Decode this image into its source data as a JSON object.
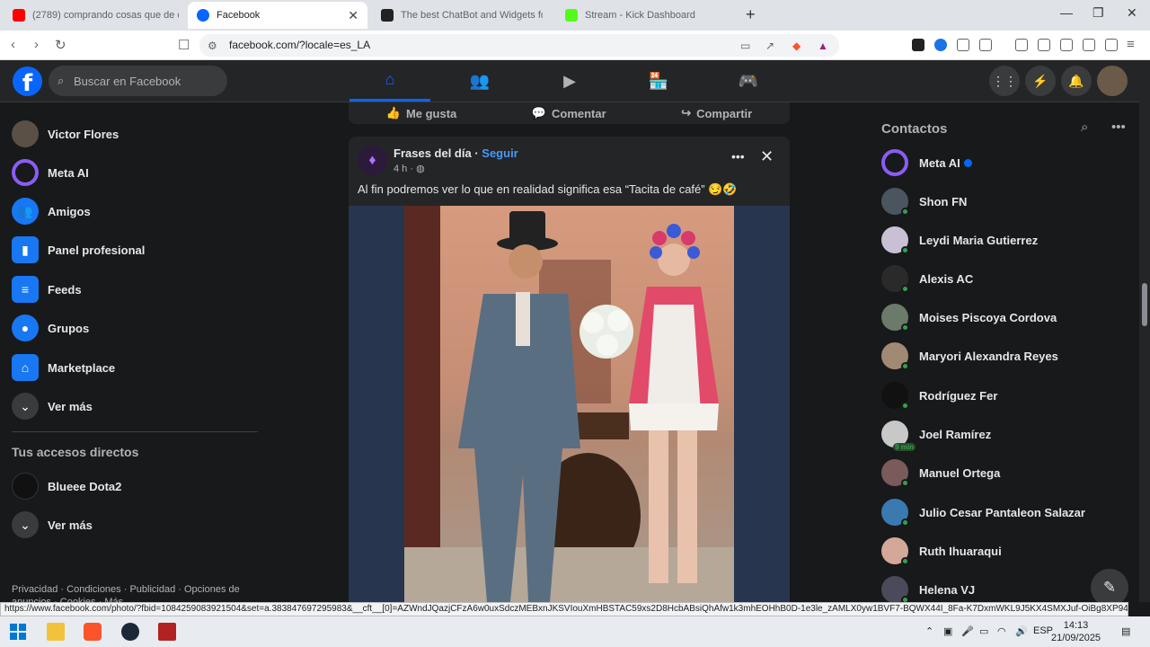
{
  "browser": {
    "tabs": [
      {
        "title": "(2789) comprando cosas que de chic",
        "color": "#ff0000"
      },
      {
        "title": "Facebook",
        "color": "#0866ff"
      },
      {
        "title": "The best ChatBot and Widgets for Kic",
        "color": "#222222"
      },
      {
        "title": "Stream - Kick Dashboard",
        "color": "#53fc18"
      }
    ],
    "url": "facebook.com/?locale=es_LA",
    "status_url": "https://www.facebook.com/photo/?fbid=1084259083921504&set=a.383847697295983&__cft__[0]=AZWndJQazjCFzA6w0uxSdczMEBxnJKSVIouXmHBSTAC59xs2D8HcbABsiQhAfw1k3mhEOHhB0D-1e3le_zAMLX0yw1BVF7-BQWX44I_8Fa-K7DxmWKL9J5KX4SMXJuf-OiBg8XP94m24Yz7..."
  },
  "fb": {
    "search_placeholder": "Buscar en Facebook",
    "brand": "#0866ff"
  },
  "left_nav": {
    "items": [
      {
        "label": "Victor Flores"
      },
      {
        "label": "Meta AI"
      },
      {
        "label": "Amigos"
      },
      {
        "label": "Panel profesional"
      },
      {
        "label": "Feeds"
      },
      {
        "label": "Grupos"
      },
      {
        "label": "Marketplace"
      },
      {
        "label": "Ver más"
      }
    ],
    "shortcuts_title": "Tus accesos directos",
    "shortcuts": [
      {
        "label": "Blueee Dota2"
      },
      {
        "label": "Ver más"
      }
    ],
    "footer": "Privacidad · Condiciones · Publicidad · Opciones de anuncios · Cookies · Más"
  },
  "feed": {
    "actions": {
      "like": "Me gusta",
      "comment": "Comentar",
      "share": "Compartir"
    },
    "post": {
      "author": "Frases del día",
      "follow": "Seguir",
      "time": "4 h ·",
      "text": "Al fin podremos ver lo que en realidad significa esa “Tacita de café” 😏🤣"
    }
  },
  "contacts": {
    "title": "Contactos",
    "list": [
      {
        "name": "Meta AI",
        "verified": true
      },
      {
        "name": "Shon FN",
        "online": true
      },
      {
        "name": "Leydi Maria Gutierrez",
        "online": true
      },
      {
        "name": "Alexis AC",
        "online": true
      },
      {
        "name": "Moises Piscoya Cordova",
        "online": true
      },
      {
        "name": "Maryori Alexandra Reyes",
        "online": true
      },
      {
        "name": "Rodríguez Fer",
        "online": true
      },
      {
        "name": "Joel Ramírez",
        "badge": "9 min"
      },
      {
        "name": "Manuel Ortega",
        "online": true
      },
      {
        "name": "Julio Cesar Pantaleon Salazar",
        "online": true
      },
      {
        "name": "Ruth Ihuaraqui",
        "online": true
      },
      {
        "name": "Helena VJ",
        "online": true
      }
    ]
  },
  "taskbar": {
    "lang": "ESP",
    "time": "14:13",
    "date": "21/09/2025"
  }
}
